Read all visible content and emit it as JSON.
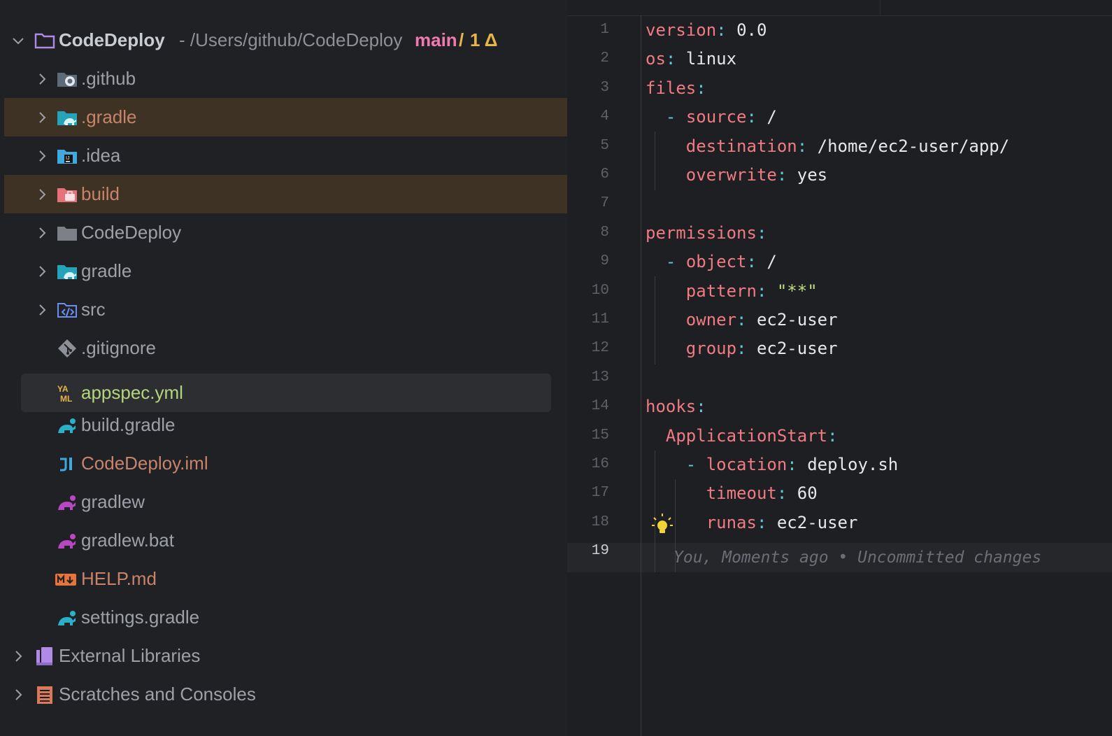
{
  "project": {
    "name": "CodeDeploy",
    "path": "- /Users/github/CodeDeploy",
    "branch": "main",
    "branch_sep": "/",
    "changes": "1 Δ"
  },
  "tree": [
    {
      "label": ".github",
      "type": "folder",
      "color_hint": "default"
    },
    {
      "label": ".gradle",
      "type": "folder",
      "color_hint": "ignored"
    },
    {
      "label": ".idea",
      "type": "folder",
      "color_hint": "default"
    },
    {
      "label": "build",
      "type": "folder",
      "color_hint": "ignored"
    },
    {
      "label": "CodeDeploy",
      "type": "folder",
      "color_hint": "default"
    },
    {
      "label": "gradle",
      "type": "folder",
      "color_hint": "default"
    },
    {
      "label": "src",
      "type": "folder",
      "color_hint": "default"
    },
    {
      "label": ".gitignore",
      "type": "file",
      "color_hint": "default"
    },
    {
      "label": "appspec.yml",
      "type": "file",
      "color_hint": "modified",
      "selected": true
    },
    {
      "label": "build.gradle",
      "type": "file",
      "color_hint": "default"
    },
    {
      "label": "CodeDeploy.iml",
      "type": "file",
      "color_hint": "ignored-text"
    },
    {
      "label": "gradlew",
      "type": "file",
      "color_hint": "default"
    },
    {
      "label": "gradlew.bat",
      "type": "file",
      "color_hint": "default"
    },
    {
      "label": "HELP.md",
      "type": "file",
      "color_hint": "ignored-text"
    },
    {
      "label": "settings.gradle",
      "type": "file",
      "color_hint": "default"
    }
  ],
  "bottom": {
    "external_libraries": "External Libraries",
    "scratches": "Scratches and Consoles"
  },
  "icons": {
    "project": "folder-outline-icon",
    "github": "github-folder-icon",
    "gradle_folder": "gradle-folder-icon",
    "idea": "idea-folder-icon",
    "build": "build-folder-icon",
    "folder": "folder-icon",
    "src": "source-folder-icon",
    "gitignore": "git-icon",
    "yaml": "yaml-icon",
    "gradle": "gradle-elephant-icon",
    "iml": "intellij-module-icon",
    "gradlew": "gradle-wrapper-icon",
    "markdown": "markdown-icon",
    "libraries": "library-icon",
    "scratches": "scratches-icon",
    "bulb": "lightbulb-icon"
  },
  "colors": {
    "ignored_row": "#3d3224",
    "key": "#f07b83",
    "punct": "#60c8d4",
    "string": "#c0dd7e",
    "branch": "#f07ab0",
    "changes": "#e8b54a"
  },
  "editor": {
    "lines": [
      {
        "n": "1",
        "indent": "",
        "key": "version",
        "dash": "",
        "value": "0.0"
      },
      {
        "n": "2",
        "indent": "",
        "key": "os",
        "dash": "",
        "value": "linux"
      },
      {
        "n": "3",
        "indent": "",
        "key": "files",
        "dash": "",
        "value": ""
      },
      {
        "n": "4",
        "indent": "  ",
        "key": "source",
        "dash": "- ",
        "value": "/"
      },
      {
        "n": "5",
        "indent": "    ",
        "key": "destination",
        "dash": "",
        "value": "/home/ec2-user/app/"
      },
      {
        "n": "6",
        "indent": "    ",
        "key": "overwrite",
        "dash": "",
        "value": "yes"
      },
      {
        "n": "7",
        "indent": "",
        "key": "",
        "dash": "",
        "value": ""
      },
      {
        "n": "8",
        "indent": "",
        "key": "permissions",
        "dash": "",
        "value": ""
      },
      {
        "n": "9",
        "indent": "  ",
        "key": "object",
        "dash": "- ",
        "value": "/"
      },
      {
        "n": "10",
        "indent": "    ",
        "key": "pattern",
        "dash": "",
        "value": "\"**\"",
        "string": true
      },
      {
        "n": "11",
        "indent": "    ",
        "key": "owner",
        "dash": "",
        "value": "ec2-user"
      },
      {
        "n": "12",
        "indent": "    ",
        "key": "group",
        "dash": "",
        "value": "ec2-user"
      },
      {
        "n": "13",
        "indent": "",
        "key": "",
        "dash": "",
        "value": ""
      },
      {
        "n": "14",
        "indent": "",
        "key": "hooks",
        "dash": "",
        "value": ""
      },
      {
        "n": "15",
        "indent": "  ",
        "key": "ApplicationStart",
        "dash": "",
        "value": ""
      },
      {
        "n": "16",
        "indent": "    ",
        "key": "location",
        "dash": "- ",
        "value": "deploy.sh"
      },
      {
        "n": "17",
        "indent": "      ",
        "key": "timeout",
        "dash": "",
        "value": "60"
      },
      {
        "n": "18",
        "indent": "      ",
        "key": "runas",
        "dash": "",
        "value": "ec2-user"
      },
      {
        "n": "19",
        "indent": "",
        "key": "",
        "dash": "",
        "value": ""
      }
    ],
    "current_line": "19",
    "blame": "You, Moments ago • Uncommitted changes"
  }
}
